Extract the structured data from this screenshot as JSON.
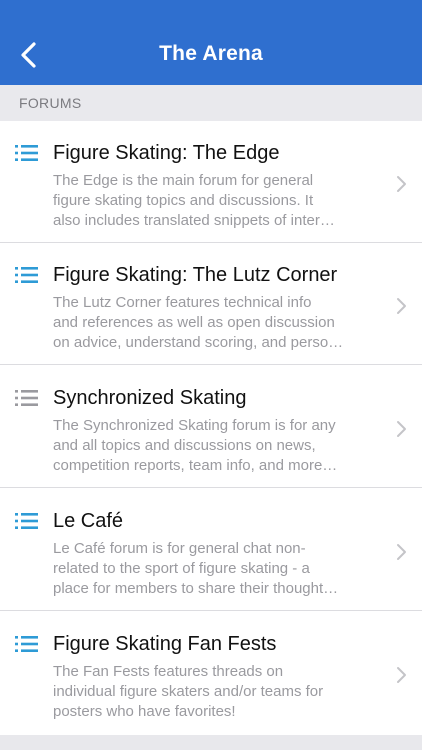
{
  "nav": {
    "title": "The Arena"
  },
  "section": {
    "label": "FORUMS"
  },
  "colors": {
    "navbar": "#2f6fcf",
    "icon_active": "#2e9bd6",
    "icon_inactive": "#9a9a9f"
  },
  "forums": [
    {
      "title": "Figure Skating: The Edge",
      "desc1": "The Edge is the main forum for general",
      "desc2": "figure skating topics and discussions. It",
      "desc3": "also includes translated snippets of inter…",
      "icon": "list-icon",
      "icon_state": "active"
    },
    {
      "title": "Figure Skating: The Lutz Corner",
      "desc1": "The Lutz Corner features technical info",
      "desc2": "and references as well as open discussion",
      "desc3": "on advice, understand scoring, and perso…",
      "icon": "list-icon",
      "icon_state": "active"
    },
    {
      "title": "Synchronized Skating",
      "desc1": "The Synchronized Skating forum is for any",
      "desc2": "and all topics and discussions on news,",
      "desc3": "competition reports, team info, and more…",
      "icon": "list-icon",
      "icon_state": "inactive"
    },
    {
      "title": "Le Café",
      "desc1": "Le Café forum is for general chat non-",
      "desc2": "related to the sport of figure skating - a",
      "desc3": "place for members to share their thought…",
      "icon": "list-icon",
      "icon_state": "active"
    },
    {
      "title": "Figure Skating Fan Fests",
      "desc1": "The Fan Fests features threads on",
      "desc2": "individual figure skaters and/or teams for",
      "desc3": "posters who have favorites!",
      "icon": "list-icon",
      "icon_state": "active"
    }
  ]
}
